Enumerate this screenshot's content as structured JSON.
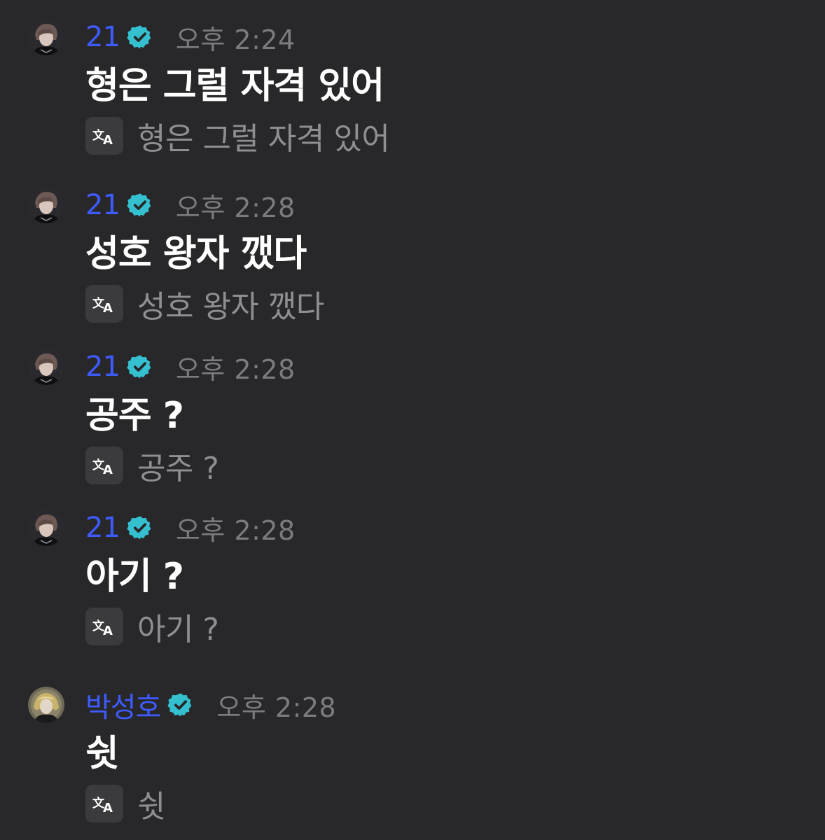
{
  "messages": [
    {
      "sender": "21",
      "time": "오후 2:24",
      "text": "형은 그럴 자격 있어",
      "translation": "형은 그럴 자격 있어",
      "avatar": "avatar-21",
      "verified_icon": "verified-badge-icon",
      "translate_icon": "translate-icon"
    },
    {
      "sender": "21",
      "time": "오후 2:28",
      "text": "성호 왕자 깼다",
      "translation": "성호 왕자 깼다",
      "avatar": "avatar-21",
      "verified_icon": "verified-badge-icon",
      "translate_icon": "translate-icon"
    },
    {
      "sender": "21",
      "time": "오후 2:28",
      "text": "공주 ?",
      "translation": "공주 ?",
      "avatar": "avatar-21",
      "verified_icon": "verified-badge-icon",
      "translate_icon": "translate-icon"
    },
    {
      "sender": "21",
      "time": "오후 2:28",
      "text": "아기 ?",
      "translation": "아기 ?",
      "avatar": "avatar-21",
      "verified_icon": "verified-badge-icon",
      "translate_icon": "translate-icon"
    },
    {
      "sender": "박성호",
      "time": "오후 2:28",
      "text": "쉿",
      "translation": "쉿",
      "avatar": "avatar-parksungho",
      "verified_icon": "verified-badge-icon",
      "translate_icon": "translate-icon"
    }
  ],
  "colors": {
    "background": "#28282a",
    "sender_name": "#3d5bff",
    "verified_badge": "#35c0d0",
    "timestamp": "#7c7c80",
    "message_text": "#ffffff",
    "translation_text": "#8e8e93",
    "translate_button_bg": "#3b3b3d"
  }
}
